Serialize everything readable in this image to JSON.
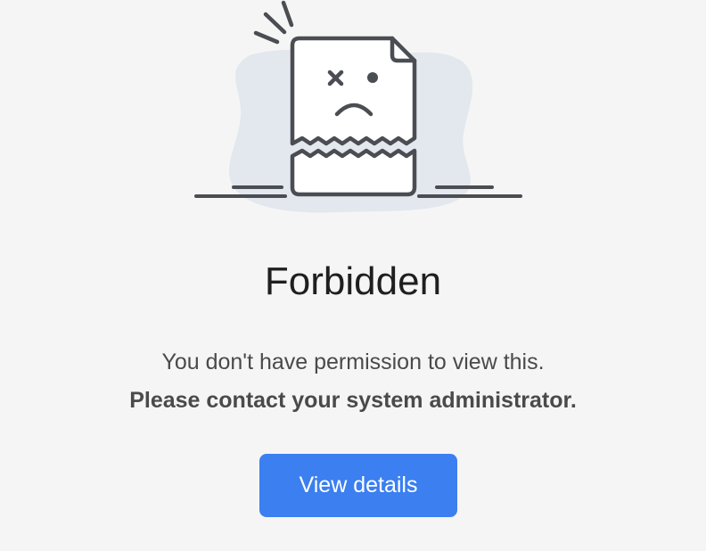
{
  "illustration": {
    "icon": "torn-document-sad-face-icon",
    "blob_color": "#e3e7ee",
    "stroke_color": "#4a4d52"
  },
  "error": {
    "title": "Forbidden",
    "message": "You don't have permission to view this.",
    "instruction": "Please contact your system administrator."
  },
  "actions": {
    "details_label": "View details",
    "accent_color": "#3b7ff0"
  }
}
